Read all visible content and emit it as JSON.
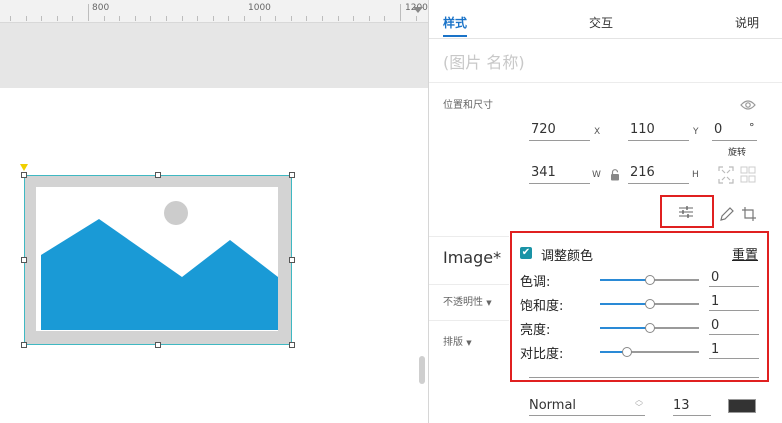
{
  "ruler": {
    "labels": [
      "800",
      "1000",
      "1200"
    ]
  },
  "tabs": {
    "style": "样式",
    "interaction": "交互",
    "notes": "说明"
  },
  "widget_name_placeholder": "(图片 名称)",
  "position_size": {
    "label": "位置和尺寸",
    "x": "720",
    "x_unit": "X",
    "y": "110",
    "y_unit": "Y",
    "rotation": "0",
    "rotation_unit": "°",
    "rotation_label": "旋转",
    "w": "341",
    "w_unit": "W",
    "h": "216",
    "h_unit": "H"
  },
  "image_section": {
    "title": "Image*",
    "opacity_label": "不透明性",
    "layout_label": "排版"
  },
  "adjust_popup": {
    "checkbox_label": "调整颜色",
    "checked": true,
    "reset_label": "重置",
    "sliders": [
      {
        "label": "色调:",
        "value": "0",
        "level": 0.5
      },
      {
        "label": "饱和度:",
        "value": "1",
        "level": 0.5
      },
      {
        "label": "亮度:",
        "value": "0",
        "level": 0.5
      },
      {
        "label": "对比度:",
        "value": "1",
        "level": 0.27
      }
    ]
  },
  "font": {
    "weight": "Normal",
    "size": "13",
    "color": "#333333"
  },
  "colors": {
    "accent": "#1a73c8",
    "highlight_box": "#e02020",
    "image_blue": "#1a9ad6",
    "selection": "#3fb8c2"
  }
}
